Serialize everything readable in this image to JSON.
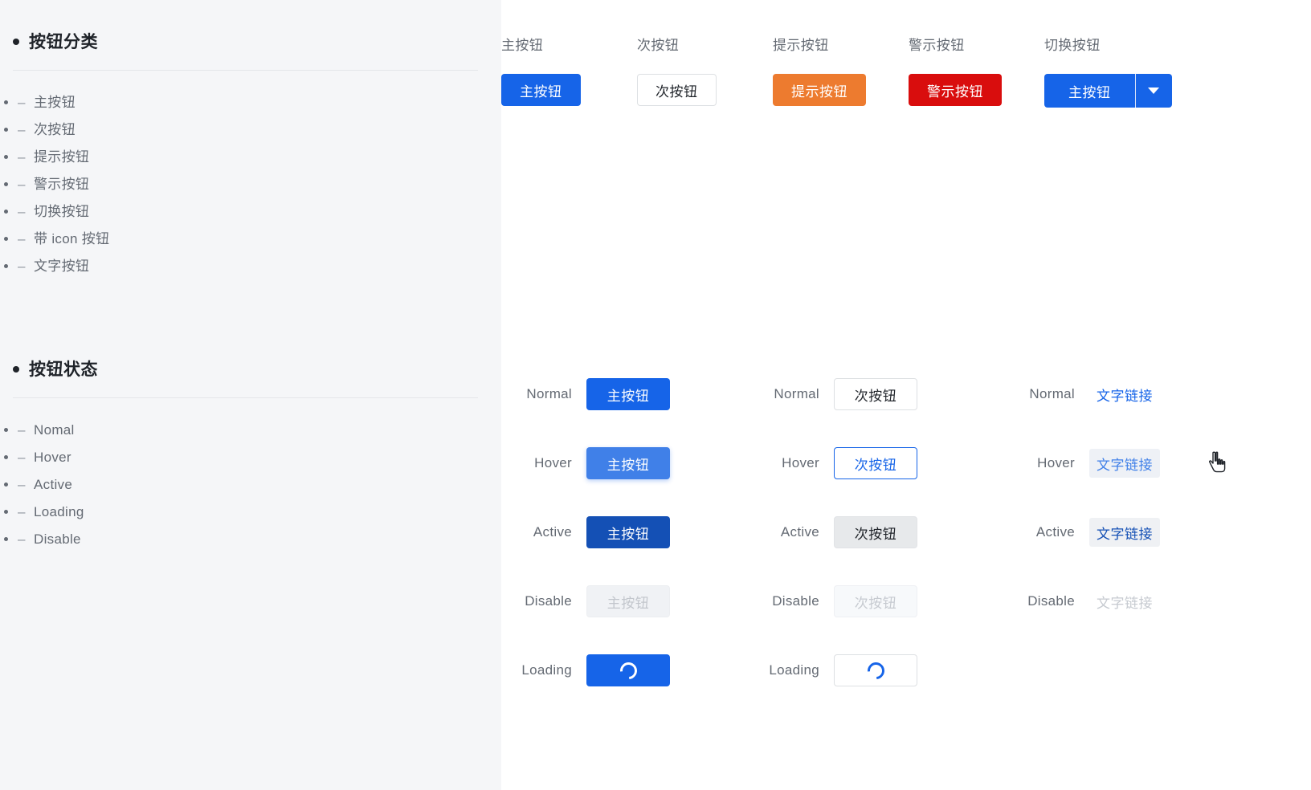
{
  "sidebar": {
    "sections": [
      {
        "title": "按钮分类",
        "bullet_icon": "bullet-dot-icon",
        "items": [
          "主按钮",
          "次按钮",
          "提示按钮",
          "警示按钮",
          "切换按钮",
          "带 icon 按钮",
          "文字按钮"
        ]
      },
      {
        "title": "按钮状态",
        "bullet_icon": "bullet-dot-icon",
        "items": [
          "Nomal",
          "Hover",
          "Active",
          "Loading",
          "Disable"
        ]
      }
    ],
    "dash": "–",
    "background_color": "#f5f6f8"
  },
  "categories": [
    {
      "label": "主按钮",
      "button_text": "主按钮",
      "style": "primary",
      "color": "#1664e8"
    },
    {
      "label": "次按钮",
      "button_text": "次按钮",
      "style": "secondary",
      "color": "#ffffff"
    },
    {
      "label": "提示按钮",
      "button_text": "提示按钮",
      "style": "warning",
      "color": "#ed7b2f"
    },
    {
      "label": "警示按钮",
      "button_text": "警示按钮",
      "style": "danger",
      "color": "#d90d0d"
    },
    {
      "label": "切换按钮",
      "button_text": "主按钮",
      "style": "split",
      "color": "#1664e8",
      "caret_icon": "chevron-down-icon"
    }
  ],
  "states": {
    "rows": [
      {
        "primary": {
          "state": "Normal",
          "text": "主按钮"
        },
        "secondary": {
          "state": "Normal",
          "text": "次按钮"
        },
        "link": {
          "state": "Normal",
          "text": "文字链接"
        }
      },
      {
        "primary": {
          "state": "Hover",
          "text": "主按钮"
        },
        "secondary": {
          "state": "Hover",
          "text": "次按钮"
        },
        "link": {
          "state": "Hover",
          "text": "文字链接"
        }
      },
      {
        "primary": {
          "state": "Active",
          "text": "主按钮"
        },
        "secondary": {
          "state": "Active",
          "text": "次按钮"
        },
        "link": {
          "state": "Active",
          "text": "文字链接"
        }
      },
      {
        "primary": {
          "state": "Disable",
          "text": "主按钮"
        },
        "secondary": {
          "state": "Disable",
          "text": "次按钮"
        },
        "link": {
          "state": "Disable",
          "text": "文字链接"
        }
      },
      {
        "primary": {
          "state": "Loading",
          "text": "",
          "icon": "spinner-icon"
        },
        "secondary": {
          "state": "Loading",
          "text": "",
          "icon": "spinner-icon"
        },
        "link": {
          "state": "",
          "text": ""
        }
      }
    ]
  },
  "cursor": {
    "icon": "pointer-hand-cursor"
  },
  "colors": {
    "primary": "#1664e8",
    "primary_hover": "#4080e8",
    "primary_active": "#1450b5",
    "warning": "#ed7b2f",
    "danger": "#d90d0d",
    "text": "#1f2329",
    "text_muted": "#646a73",
    "disabled": "#c6cad0"
  }
}
